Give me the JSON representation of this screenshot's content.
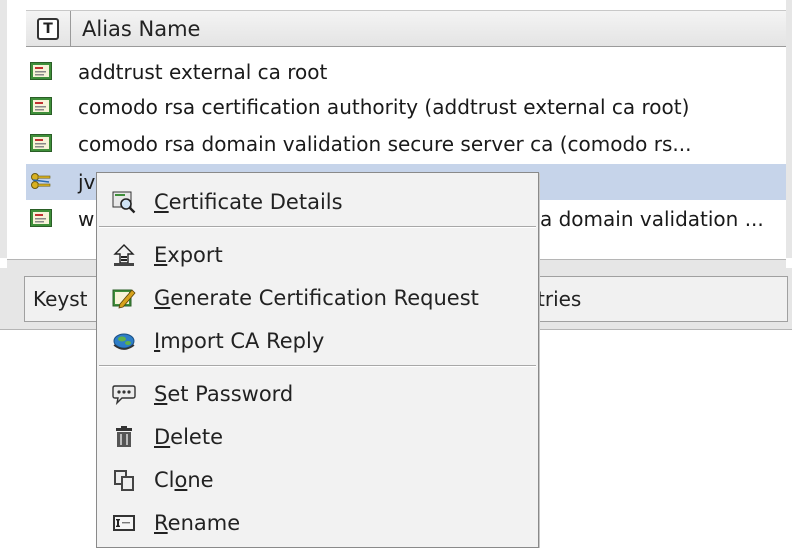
{
  "table": {
    "type_column_header": "T",
    "alias_column_header": "Alias Name",
    "rows": [
      {
        "alias": "addtrust external ca root",
        "icon": "trusted-certificate-icon"
      },
      {
        "alias": "comodo rsa certification authority (addtrust external ca root)",
        "icon": "trusted-certificate-icon"
      },
      {
        "alias": "comodo rsa domain validation secure server ca (comodo rs...",
        "icon": "trusted-certificate-icon"
      },
      {
        "alias": "jv",
        "icon": "key-pair-icon",
        "selected": true
      },
      {
        "alias_start": "w",
        "alias_end": "a domain validation ...",
        "icon": "trusted-certificate-icon"
      }
    ]
  },
  "status_bar": {
    "left_text": "Keyst",
    "right_text": "tries"
  },
  "context_menu": {
    "items": [
      {
        "label_pre": "",
        "label_mn": "C",
        "label_post": "ertificate Details",
        "icon": "certificate-details-icon"
      },
      {
        "label_pre": "",
        "label_mn": "E",
        "label_post": "xport",
        "icon": "export-icon"
      },
      {
        "label_pre": "",
        "label_mn": "G",
        "label_post": "enerate Certification Request",
        "icon": "generate-request-icon"
      },
      {
        "label_pre": "",
        "label_mn": "I",
        "label_post": "mport CA Reply",
        "icon": "import-ca-reply-icon"
      },
      {
        "label_pre": "",
        "label_mn": "S",
        "label_post": "et Password",
        "icon": "set-password-icon"
      },
      {
        "label_pre": "",
        "label_mn": "D",
        "label_post": "elete",
        "icon": "delete-icon"
      },
      {
        "label_pre": "Cl",
        "label_mn": "o",
        "label_post": "ne",
        "icon": "clone-icon"
      },
      {
        "label_pre": "",
        "label_mn": "R",
        "label_post": "ename",
        "icon": "rename-icon"
      }
    ]
  },
  "colors": {
    "selection": "#c6d4ea",
    "menu_background": "#f2f2f2",
    "panel_background": "#e6e6e6"
  }
}
